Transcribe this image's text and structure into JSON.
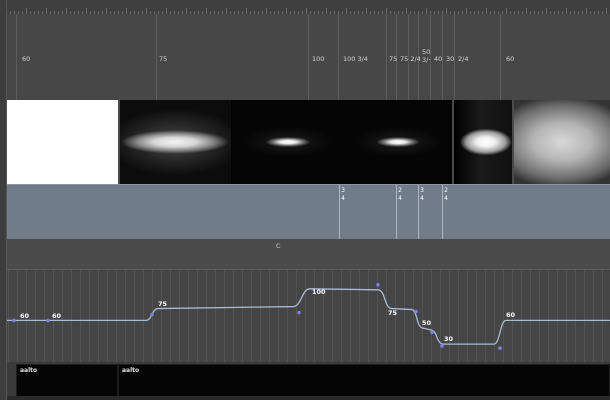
{
  "tempo_markers": [
    {
      "label": "60",
      "bar": 0
    },
    {
      "label": "75",
      "bar": 9
    },
    {
      "label": "100",
      "bar": 17
    },
    {
      "label": "100 3/4",
      "bar": 19
    },
    {
      "label": "75",
      "bar": 22
    },
    {
      "label": "75 2/4",
      "bar": 23
    },
    {
      "label": "50 3/·",
      "bar": 24
    },
    {
      "label": "40",
      "bar": 25
    },
    {
      "label": "30",
      "bar": 26
    },
    {
      "label": "2/4",
      "bar": 27
    },
    {
      "label": "60",
      "bar": 29
    }
  ],
  "thumbnails": [
    {
      "kind": "white"
    },
    {
      "kind": "wide-glow"
    },
    {
      "kind": "small-glow"
    },
    {
      "kind": "small-glow"
    },
    {
      "kind": "bright-center"
    },
    {
      "kind": "gray-wide"
    }
  ],
  "time_signatures": [
    {
      "top": "3",
      "bottom": "4"
    },
    {
      "top": "2",
      "bottom": "4"
    },
    {
      "top": "3",
      "bottom": "4"
    },
    {
      "top": "2",
      "bottom": "4"
    }
  ],
  "key_lane": {
    "label": "C"
  },
  "tempo_curve": {
    "points": [
      {
        "label": "60",
        "value": 60
      },
      {
        "label": "60",
        "value": 60
      },
      {
        "label": "75",
        "value": 75
      },
      {
        "label": "100",
        "value": 100
      },
      {
        "label": "75",
        "value": 75
      },
      {
        "label": "50",
        "value": 50
      },
      {
        "label": "30",
        "value": 30
      },
      {
        "label": "60",
        "value": 60
      }
    ]
  },
  "regions": [
    {
      "label": "aalto"
    },
    {
      "label": "aalto"
    }
  ],
  "colors": {
    "tempo_curve": "#a9bcd4",
    "tempo_node": "#7f7fe0",
    "ts_lane": "#717c89"
  }
}
